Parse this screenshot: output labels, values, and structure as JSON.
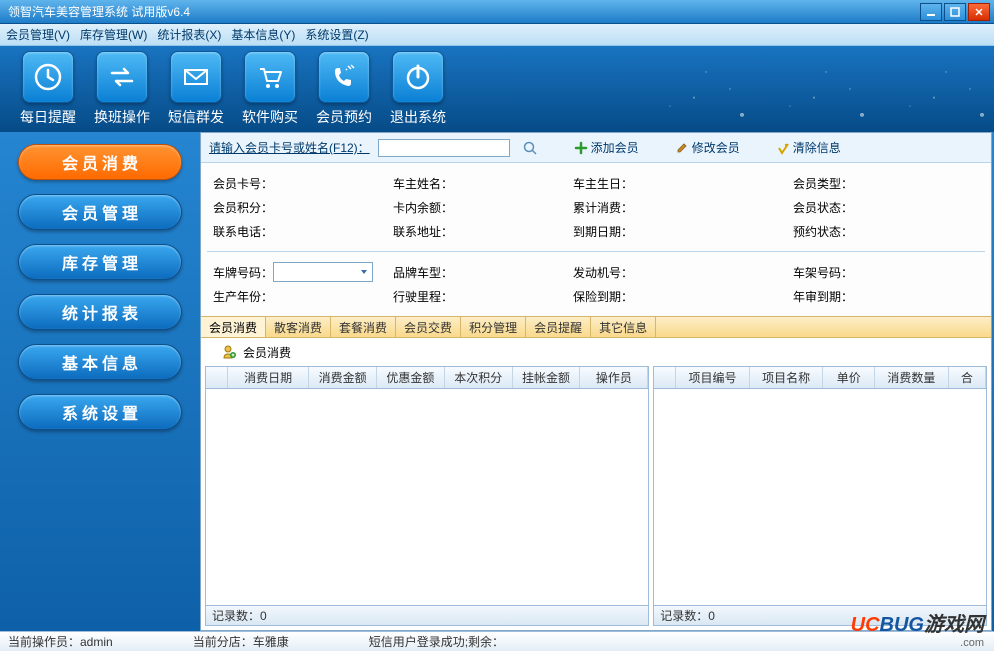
{
  "window": {
    "title": "领智汽车美容管理系统 试用版v6.4"
  },
  "menu": [
    "会员管理(V)",
    "库存管理(W)",
    "统计报表(X)",
    "基本信息(Y)",
    "系统设置(Z)"
  ],
  "toolbar": [
    "每日提醒",
    "换班操作",
    "短信群发",
    "软件购买",
    "会员预约",
    "退出系统"
  ],
  "sidebar": [
    "会员消费",
    "会员管理",
    "库存管理",
    "统计报表",
    "基本信息",
    "系统设置"
  ],
  "search": {
    "label": "请输入会员卡号或姓名(F12)：",
    "add": "添加会员",
    "edit": "修改会员",
    "clear": "清除信息"
  },
  "info": {
    "row1": [
      "会员卡号：",
      "车主姓名：",
      "车主生日：",
      "会员类型："
    ],
    "row2": [
      "会员积分：",
      "卡内余额：",
      "累计消费：",
      "会员状态："
    ],
    "row3": [
      "联系电话：",
      "联系地址：",
      "到期日期：",
      "预约状态："
    ],
    "row4": [
      "车牌号码：",
      "品牌车型：",
      "发动机号：",
      "车架号码："
    ],
    "row5": [
      "生产年份：",
      "行驶里程：",
      "保险到期：",
      "年审到期："
    ]
  },
  "tabs": [
    "会员消费",
    "散客消费",
    "套餐消费",
    "会员交费",
    "积分管理",
    "会员提醒",
    "其它信息"
  ],
  "subheader": "会员消费",
  "leftTable": {
    "cols": [
      "消费日期",
      "消费金额",
      "优惠金额",
      "本次积分",
      "挂帐金额",
      "操作员"
    ],
    "footer": "记录数：0"
  },
  "rightTable": {
    "cols": [
      "项目编号",
      "项目名称",
      "单价",
      "消费数量",
      "合"
    ],
    "footer": "记录数：0"
  },
  "status": {
    "operator": "当前操作员：admin",
    "branch": "当前分店：车雅康",
    "sms": "短信用户登录成功;剩余："
  }
}
